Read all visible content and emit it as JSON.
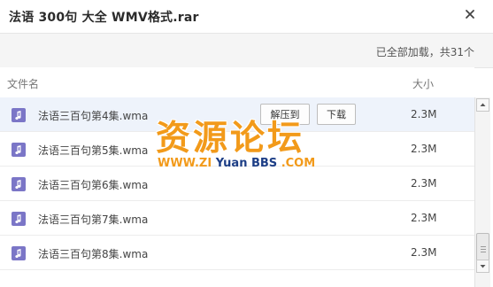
{
  "dialog": {
    "title": "法语 300句 大全 WMV格式.rar",
    "status_text": "已全部加载，共31个"
  },
  "columns": {
    "name": "文件名",
    "size": "大小"
  },
  "files": [
    {
      "name": "法语三百句第4集.wma",
      "size": "2.3M",
      "hover_actions": {
        "extract": "解压到",
        "download": "下载"
      }
    },
    {
      "name": "法语三百句第5集.wma",
      "size": "2.3M"
    },
    {
      "name": "法语三百句第6集.wma",
      "size": "2.3M"
    },
    {
      "name": "法语三百句第7集.wma",
      "size": "2.3M"
    },
    {
      "name": "法语三百句第8集.wma",
      "size": "2.3M"
    }
  ],
  "watermark": {
    "cn": "资源论坛",
    "en_part1": "WWW.",
    "en_part2": "ZI",
    "en_part3": " Yuan ",
    "en_part4": "BBS",
    "en_part5": " .COM"
  },
  "colors": {
    "accent_orange": "#f29a1a",
    "file_icon": "#7b76c7",
    "watermark_blue": "#1d3e86"
  },
  "icons": {
    "close": "close-icon",
    "file": "music-file-icon"
  }
}
